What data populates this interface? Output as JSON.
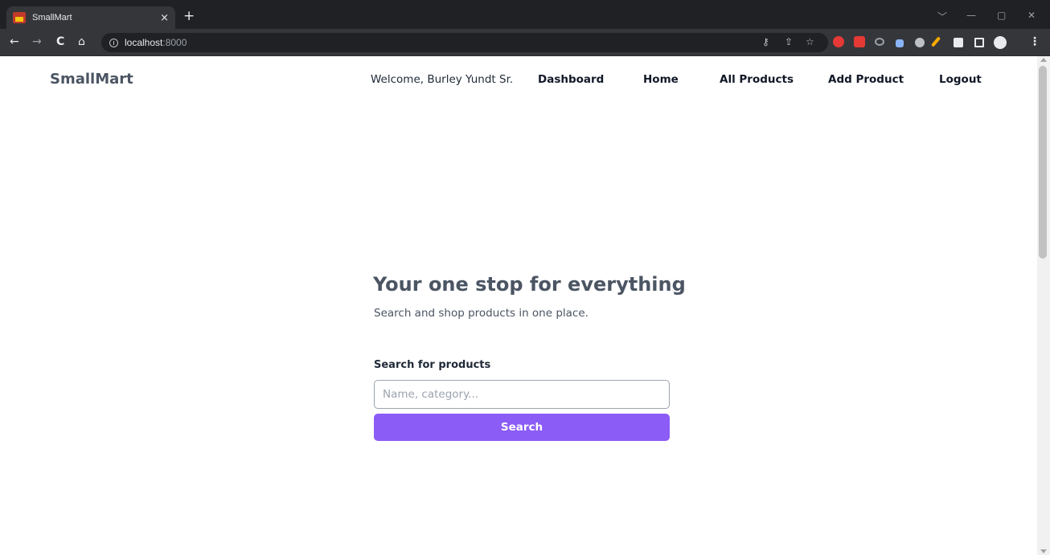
{
  "browser": {
    "tab_title": "SmallMart",
    "tab_close": "×",
    "new_tab": "+",
    "url_host": "localhost",
    "url_port": ":8000",
    "window_controls": [
      "﹀",
      "—",
      "▢",
      "✕"
    ],
    "nav_buttons": {
      "back": "←",
      "forward": "→",
      "reload": "C",
      "home": "⌂"
    },
    "icons": [
      "key-icon",
      "share-icon",
      "star-icon",
      "adblock-icon",
      "extension-s-icon",
      "glasses-icon",
      "pen-icon",
      "globe-icon",
      "pencil-icon",
      "puzzle-icon",
      "sidepanel-icon",
      "profile-icon",
      "menu-icon"
    ]
  },
  "header": {
    "brand": "SmallMart",
    "welcome": "Welcome, Burley Yundt Sr.",
    "nav": {
      "dashboard": "Dashboard",
      "home": "Home",
      "all_products": "All Products",
      "add_product": "Add Product",
      "logout": "Logout"
    }
  },
  "hero": {
    "title": "Your one stop for everything",
    "subtitle": "Search and shop products in one place."
  },
  "search": {
    "label": "Search for products",
    "placeholder": "Name, category...",
    "value": "",
    "button_label": "Search"
  },
  "colors": {
    "accent": "#8b5cf6",
    "heading": "#4b5563",
    "chrome_dark": "#202124",
    "chrome_toolbar": "#35363a"
  }
}
